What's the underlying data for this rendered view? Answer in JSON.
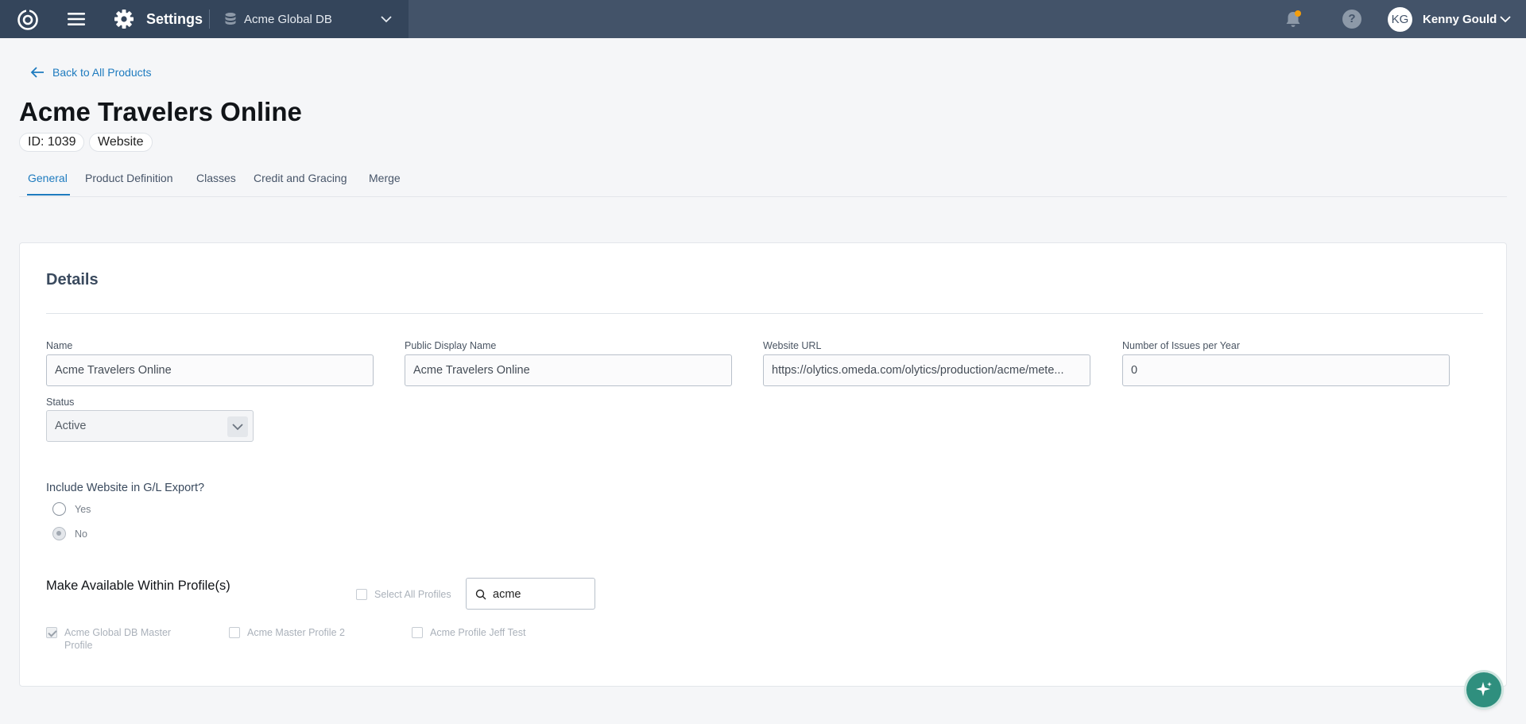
{
  "topbar": {
    "app_title": "Settings",
    "database": "Acme Global DB",
    "user_initials": "KG",
    "user_name": "Kenny Gould",
    "help_glyph": "?",
    "icons": [
      "logo-icon",
      "menu-icon",
      "gear-icon",
      "database-icon",
      "chevron-down-icon",
      "bell-icon",
      "help-icon"
    ],
    "notification_dot_color": "#f59e0b"
  },
  "header": {
    "back_link": "Back to All Products",
    "title": "Acme Travelers Online",
    "id_pill": "ID: 1039",
    "type_pill": "Website"
  },
  "tabs": [
    {
      "label": "General",
      "active": true
    },
    {
      "label": "Product Definition",
      "active": false
    },
    {
      "label": "Classes",
      "active": false
    },
    {
      "label": "Credit and Gracing",
      "active": false
    },
    {
      "label": "Merge",
      "active": false
    }
  ],
  "details": {
    "title": "Details",
    "fields": {
      "name": {
        "label": "Name",
        "value": "Acme Travelers Online"
      },
      "public_name": {
        "label": "Public Display Name",
        "value": "Acme Travelers Online"
      },
      "website_url": {
        "label": "Website URL",
        "value": "https://olytics.omeda.com/olytics/production/acme/mete..."
      },
      "issues_per_year": {
        "label": "Number of Issues per Year",
        "value": "0"
      }
    },
    "status": {
      "label": "Status",
      "value": "Active"
    },
    "gl_export": {
      "question": "Include Website in G/L Export?",
      "options": [
        {
          "label": "Yes",
          "checked": false
        },
        {
          "label": "No",
          "checked": true
        }
      ]
    },
    "profiles": {
      "title": "Make Available Within Profile(s)",
      "select_all_label": "Select All Profiles",
      "search_value": "acme",
      "items": [
        {
          "label": "Acme Global DB Master Profile",
          "line1": "Acme Global DB Master",
          "line2": "Profile",
          "checked": true
        },
        {
          "label": "Acme Master Profile 2",
          "checked": false
        },
        {
          "label": "Acme Profile Jeff Test",
          "checked": false
        }
      ]
    }
  },
  "colors": {
    "accent": "#1e7bbf",
    "topbar": "#435369",
    "fab": "#2f8f7e"
  }
}
